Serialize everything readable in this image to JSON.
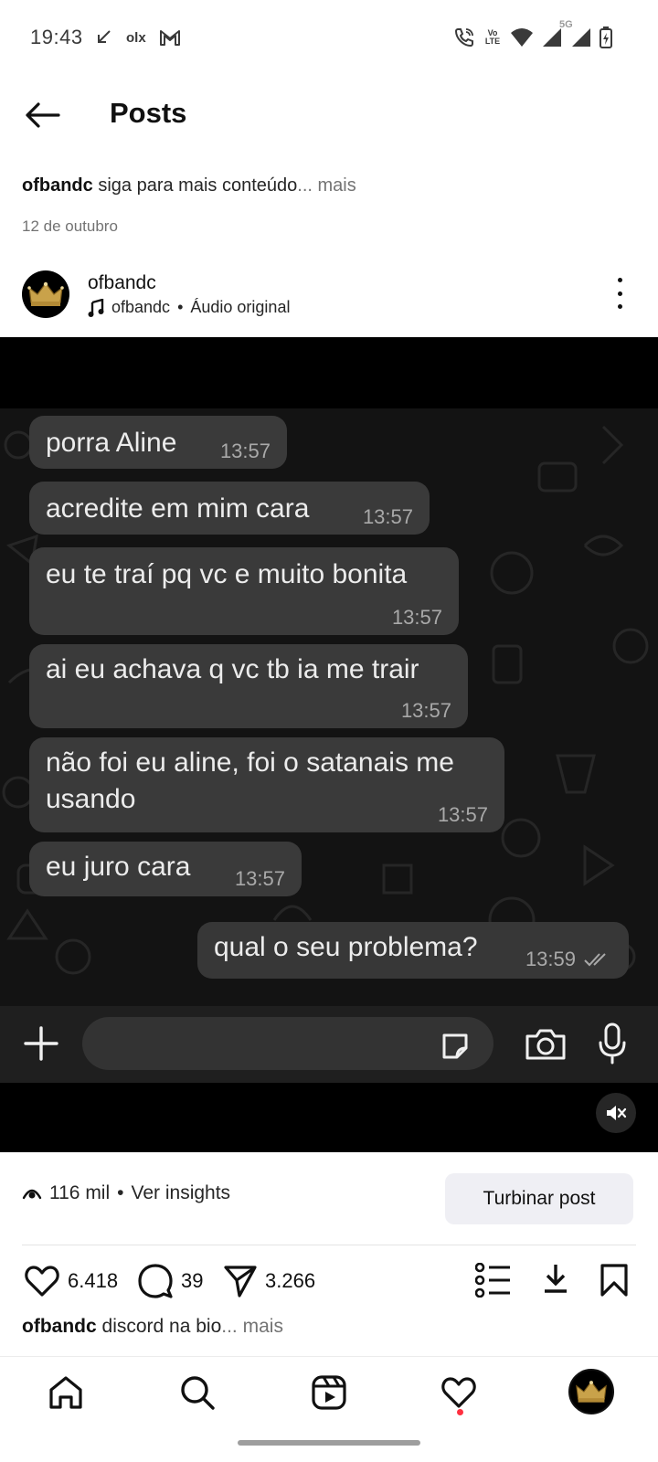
{
  "status_bar": {
    "time": "19:43",
    "left_icons": [
      "missed-call-arrow-icon",
      "olx-icon",
      "gmail-icon"
    ],
    "olx_label": "olx",
    "volte_label": "Vo LTE",
    "network_label": "5G",
    "right_icons": [
      "wifi-calling-icon",
      "volte-icon",
      "wifi-icon",
      "signal-icon",
      "signal-icon",
      "battery-charging-icon"
    ]
  },
  "header": {
    "title": "Posts"
  },
  "previous_post": {
    "username": "ofbandc",
    "caption": "siga para mais conteúdo",
    "more": "... mais",
    "date": "12 de outubro"
  },
  "post": {
    "username": "ofbandc",
    "audio_user": "ofbandc",
    "audio_separator": "•",
    "audio_label": "Áudio original"
  },
  "chat": {
    "messages": [
      {
        "text": "porra Aline",
        "time": "13:57",
        "direction": "in"
      },
      {
        "text": "acredite em mim cara",
        "time": "13:57",
        "direction": "in"
      },
      {
        "text": "eu te traí pq vc e muito bonita",
        "time": "13:57",
        "direction": "in"
      },
      {
        "text": "ai eu achava q vc tb ia me trair",
        "time": "13:57",
        "direction": "in"
      },
      {
        "text": "não foi eu aline, foi o satanais me usando",
        "text_line1": "não foi eu aline, foi o satanais me",
        "text_line2": "usando",
        "time": "13:57",
        "direction": "in"
      },
      {
        "text": "eu juro cara",
        "time": "13:57",
        "direction": "in"
      },
      {
        "text": "qual o seu problema?",
        "time": "13:59",
        "direction": "out",
        "status": "read-double-check"
      }
    ],
    "input_icons": [
      "plus-icon",
      "sticker-icon",
      "camera-icon",
      "microphone-icon"
    ]
  },
  "media_controls": {
    "mute_icon": "speaker-muted-icon"
  },
  "insights": {
    "views": "116 mil",
    "separator": "•",
    "link": "Ver insights",
    "boost_label": "Turbinar post"
  },
  "actions": {
    "likes": "6.418",
    "comments": "39",
    "shares": "3.266"
  },
  "caption": {
    "username": "ofbandc",
    "text": "discord na bio",
    "more": "... mais"
  },
  "bottom_nav": {
    "items": [
      "home-icon",
      "search-icon",
      "reels-icon",
      "heart-icon",
      "profile-avatar"
    ],
    "activity_dot_color": "#ff3040"
  },
  "colors": {
    "chat_background": "#131313",
    "bubble": "#3a3a3a",
    "boost_button": "#efeff4"
  }
}
